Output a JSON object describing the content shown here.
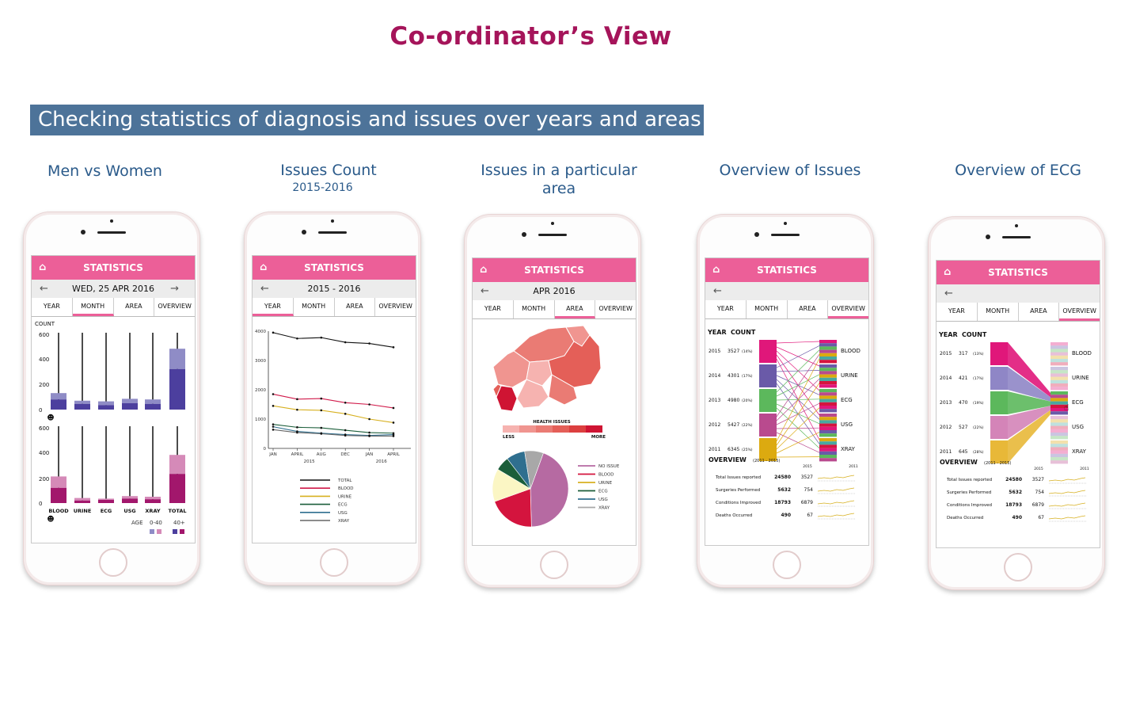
{
  "page_title": "Co-ordinator’s View",
  "banner_text": "Checking statistics of diagnosis and issues over years and areas",
  "screens": [
    {
      "section_title": "Men vs Women",
      "header_title": "STATISTICS",
      "subheader": "WED, 25 APR 2016",
      "tabs": [
        "YEAR",
        "MONTH",
        "AREA",
        "OVERVIEW"
      ],
      "active_tab": "MONTH",
      "chart_data": {
        "type": "bar",
        "ylabel": "COUNT",
        "categories": [
          "BLOOD",
          "URINE",
          "ECG",
          "USG",
          "XRAY",
          "TOTAL"
        ],
        "y_ticks": [
          "600",
          "400",
          "200",
          "0",
          "600",
          "400",
          "200",
          "0"
        ],
        "men": {
          "age_0_40": [
            80,
            45,
            35,
            50,
            45,
            320
          ],
          "age_40_plus": [
            130,
            70,
            65,
            85,
            80,
            480
          ]
        },
        "women": {
          "age_0_40": [
            120,
            20,
            25,
            35,
            30,
            230
          ],
          "age_40_plus": [
            210,
            40,
            35,
            55,
            50,
            380
          ]
        },
        "legend_title": "AGE",
        "legend_labels": [
          "0-40",
          "40+"
        ],
        "colors": {
          "men_light": "#8f8cc6",
          "men_dark": "#4c3f9e",
          "women_light": "#d58ab8",
          "women_dark": "#a2176c"
        }
      }
    },
    {
      "section_title": "Issues Count",
      "section_subtitle": "2015-2016",
      "header_title": "STATISTICS",
      "subheader": "2015 - 2016",
      "tabs": [
        "YEAR",
        "MONTH",
        "AREA",
        "OVERVIEW"
      ],
      "active_tab": "YEAR",
      "chart_data": {
        "type": "line",
        "x": [
          "JAN",
          "APRIL",
          "AUG",
          "DEC",
          "JAN",
          "APRIL"
        ],
        "x_groups": [
          "2015",
          "2016"
        ],
        "y_ticks": [
          "4000",
          "3000",
          "2000",
          "1000",
          "0"
        ],
        "ylim": [
          0,
          4000
        ],
        "series": [
          {
            "name": "TOTAL",
            "color": "#111111",
            "values": [
              3950,
              3750,
              3780,
              3620,
              3580,
              3450
            ]
          },
          {
            "name": "BLOOD",
            "color": "#d11a4a",
            "values": [
              1850,
              1680,
              1700,
              1560,
              1500,
              1380
            ]
          },
          {
            "name": "URINE",
            "color": "#d7b020",
            "values": [
              1450,
              1320,
              1300,
              1180,
              1000,
              880
            ]
          },
          {
            "name": "ECG",
            "color": "#1b5e3a",
            "values": [
              820,
              720,
              700,
              620,
              540,
              520
            ]
          },
          {
            "name": "USG",
            "color": "#2f6f8f",
            "values": [
              740,
              580,
              520,
              470,
              440,
              470
            ]
          },
          {
            "name": "XRAY",
            "color": "#666666",
            "values": [
              640,
              540,
              500,
              440,
              420,
              420
            ]
          }
        ]
      }
    },
    {
      "section_title": "Issues in a particular area",
      "header_title": "STATISTICS",
      "subheader": "APR 2016",
      "tabs": [
        "YEAR",
        "MONTH",
        "AREA",
        "OVERVIEW"
      ],
      "active_tab": "AREA",
      "map_label": "HEALTH ISSUES",
      "scale_less": "LESS",
      "scale_more": "MORE",
      "scale_colors": [
        "#f6b3b0",
        "#f09590",
        "#ea7b74",
        "#e45f58",
        "#dc3f3f",
        "#cf1433"
      ],
      "chart_data": {
        "type": "pie",
        "labels": [
          "NO ISSUE",
          "BLOOD",
          "URINE",
          "ECG",
          "USG",
          "XRAY"
        ],
        "values": [
          44,
          20,
          14,
          6,
          8,
          8
        ],
        "colors": [
          "#b66aa2",
          "#d4143e",
          "#fbf6c4",
          "#1b5e3a",
          "#2f6f8f",
          "#a8a8a8"
        ]
      }
    },
    {
      "section_title": "Overview of Issues",
      "header_title": "STATISTICS",
      "tabs": [
        "YEAR",
        "MONTH",
        "AREA",
        "OVERVIEW"
      ],
      "active_tab": "OVERVIEW",
      "col_year": "YEAR",
      "col_count": "COUNT",
      "rows": [
        {
          "year": "2015",
          "count": "3527",
          "pct": "(14%)"
        },
        {
          "year": "2014",
          "count": "4301",
          "pct": "(17%)"
        },
        {
          "year": "2013",
          "count": "4980",
          "pct": "(20%)"
        },
        {
          "year": "2012",
          "count": "5427",
          "pct": "(22%)"
        },
        {
          "year": "2011",
          "count": "6345",
          "pct": "(25%)"
        }
      ],
      "categories": [
        "BLOOD",
        "URINE",
        "ECG",
        "USG",
        "XRAY"
      ],
      "year_colors": [
        "#e0177a",
        "#6a5aa8",
        "#5cb85c",
        "#b94a8e",
        "#dcaa10"
      ],
      "overview_title": "OVERVIEW",
      "overview_range": "(2011 - 2015)",
      "spark_years": [
        "2015",
        "2011"
      ],
      "stats": [
        {
          "label": "Total Issues reported",
          "value": "24580",
          "recent": "3527"
        },
        {
          "label": "Surgeries Performed",
          "value": "5632",
          "recent": "754"
        },
        {
          "label": "Conditions Improved",
          "value": "18793",
          "recent": "6879"
        },
        {
          "label": "Deaths Occurred",
          "value": "490",
          "recent": "67"
        }
      ]
    },
    {
      "section_title": "Overview of ECG",
      "header_title": "STATISTICS",
      "tabs": [
        "YEAR",
        "MONTH",
        "AREA",
        "OVERVIEW"
      ],
      "active_tab": "OVERVIEW",
      "col_year": "YEAR",
      "col_count": "COUNT",
      "rows": [
        {
          "year": "2015",
          "count": "317",
          "pct": "(13%)"
        },
        {
          "year": "2014",
          "count": "421",
          "pct": "(17%)"
        },
        {
          "year": "2013",
          "count": "470",
          "pct": "(19%)"
        },
        {
          "year": "2012",
          "count": "527",
          "pct": "(22%)"
        },
        {
          "year": "2011",
          "count": "645",
          "pct": "(28%)"
        }
      ],
      "categories": [
        "BLOOD",
        "URINE",
        "ECG",
        "USG",
        "XRAY"
      ],
      "year_colors": [
        "#e0177a",
        "#8f86c6",
        "#5cb85c",
        "#d484b8",
        "#e8b838"
      ],
      "overview_title": "OVERVIEW",
      "overview_range": "(2011 - 2015)",
      "spark_years": [
        "2015",
        "2011"
      ],
      "stats": [
        {
          "label": "Total Issues reported",
          "value": "24580",
          "recent": "3527"
        },
        {
          "label": "Surgeries Performed",
          "value": "5632",
          "recent": "754"
        },
        {
          "label": "Conditions Improved",
          "value": "18793",
          "recent": "6879"
        },
        {
          "label": "Deaths Occurred",
          "value": "490",
          "recent": "67"
        }
      ]
    }
  ]
}
